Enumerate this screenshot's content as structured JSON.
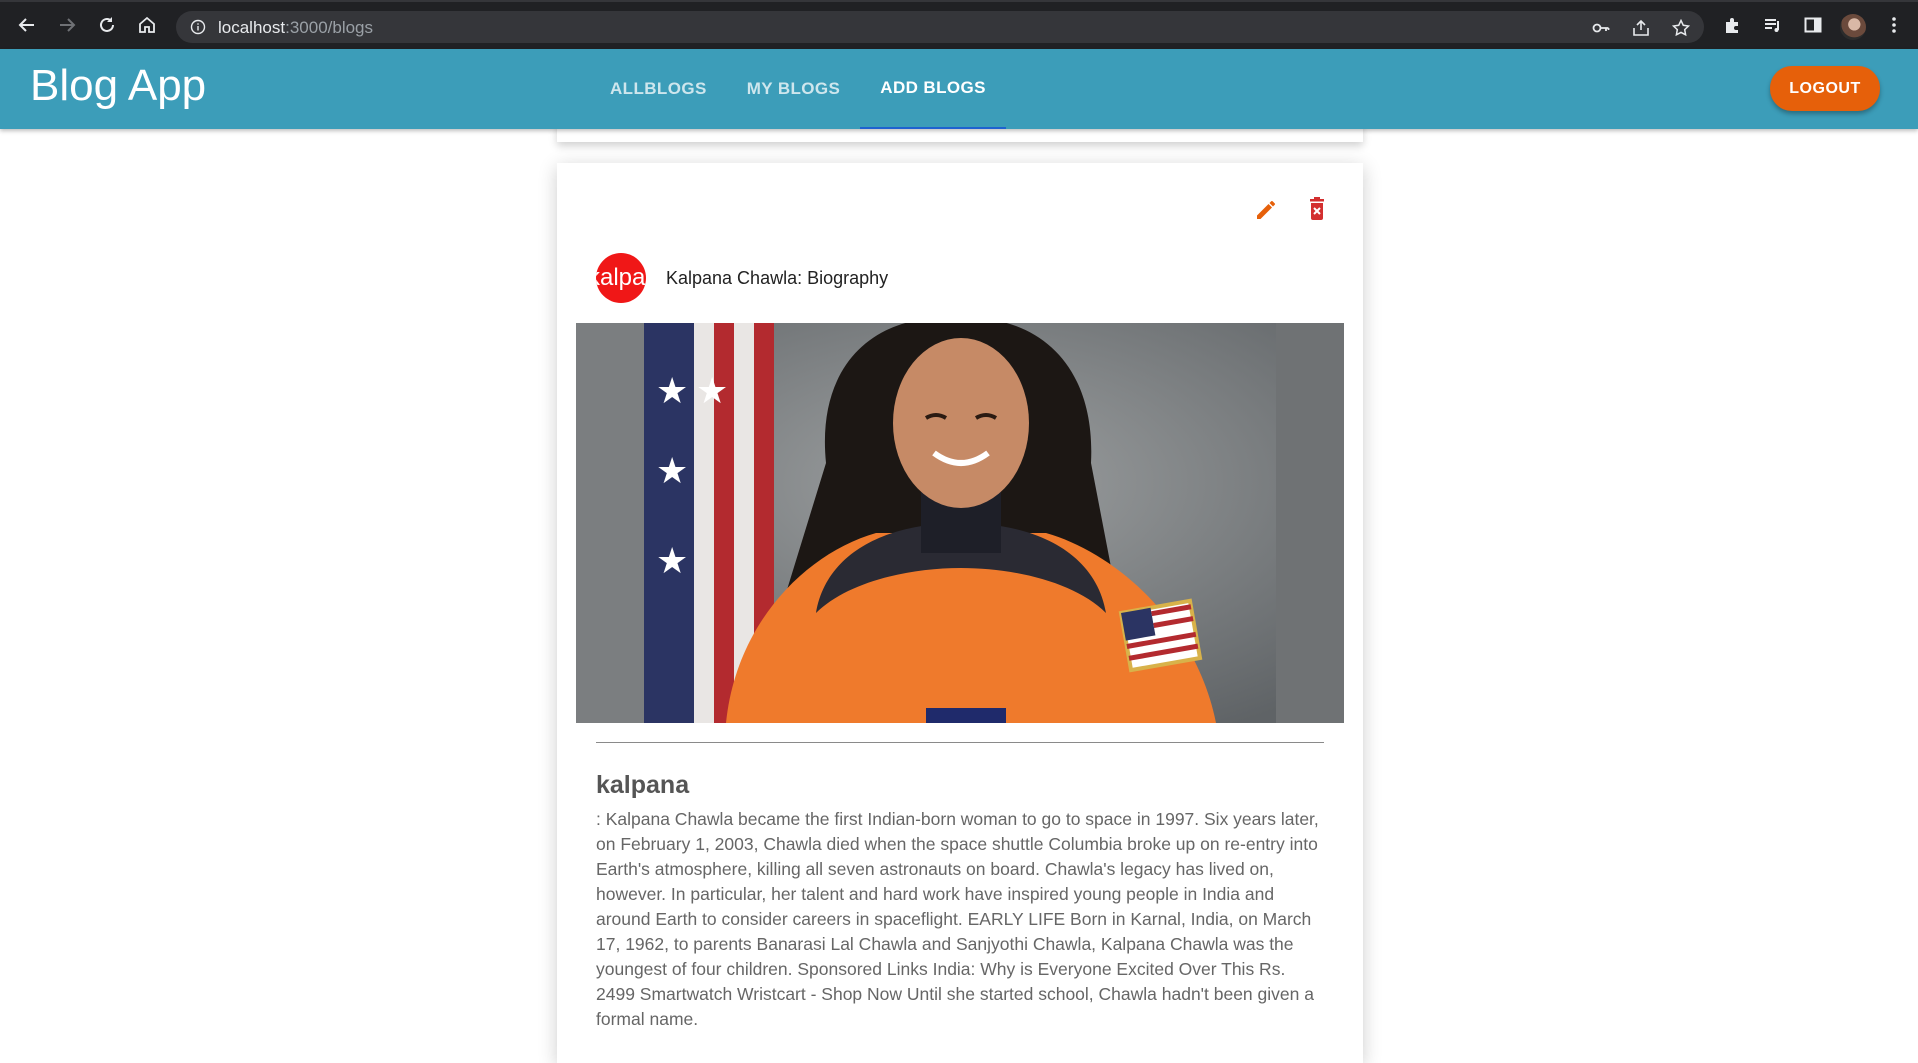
{
  "browser": {
    "url_host": "localhost",
    "url_path": ":3000/blogs"
  },
  "app": {
    "brand": "Blog App",
    "tabs": [
      {
        "label": "ALLBLOGS",
        "active": false
      },
      {
        "label": "MY BLOGS",
        "active": false
      },
      {
        "label": "ADD BLOGS",
        "active": true
      }
    ],
    "logout_label": "LOGOUT",
    "colors": {
      "appbar": "#3c9db9",
      "logout": "#e6600a",
      "edit": "#e6600a",
      "delete": "#d32f2f",
      "avatar": "#f01717"
    }
  },
  "post": {
    "avatar_text": "kalpana",
    "title": "Kalpana Chawla: Biography",
    "heading": "kalpana",
    "body": ": Kalpana Chawla became the first Indian-born woman to go to space in 1997. Six years later, on February 1, 2003, Chawla died when the space shuttle Columbia broke up on re-entry into Earth's atmosphere, killing all seven astronauts on board. Chawla's legacy has lived on, however. In particular, her talent and hard work have inspired young people in India and around Earth to consider careers in spaceflight. EARLY LIFE Born in Karnal, India, on March 17, 1962, to parents Banarasi Lal Chawla and Sanjyothi Chawla, Kalpana Chawla was the youngest of four children. Sponsored Links India: Why is Everyone Excited Over This Rs. 2499 Smartwatch Wristcart - Shop Now Until she started school, Chawla hadn't been given a formal name.",
    "icons": {
      "edit": "pencil-icon",
      "delete": "trash-x-icon"
    }
  }
}
